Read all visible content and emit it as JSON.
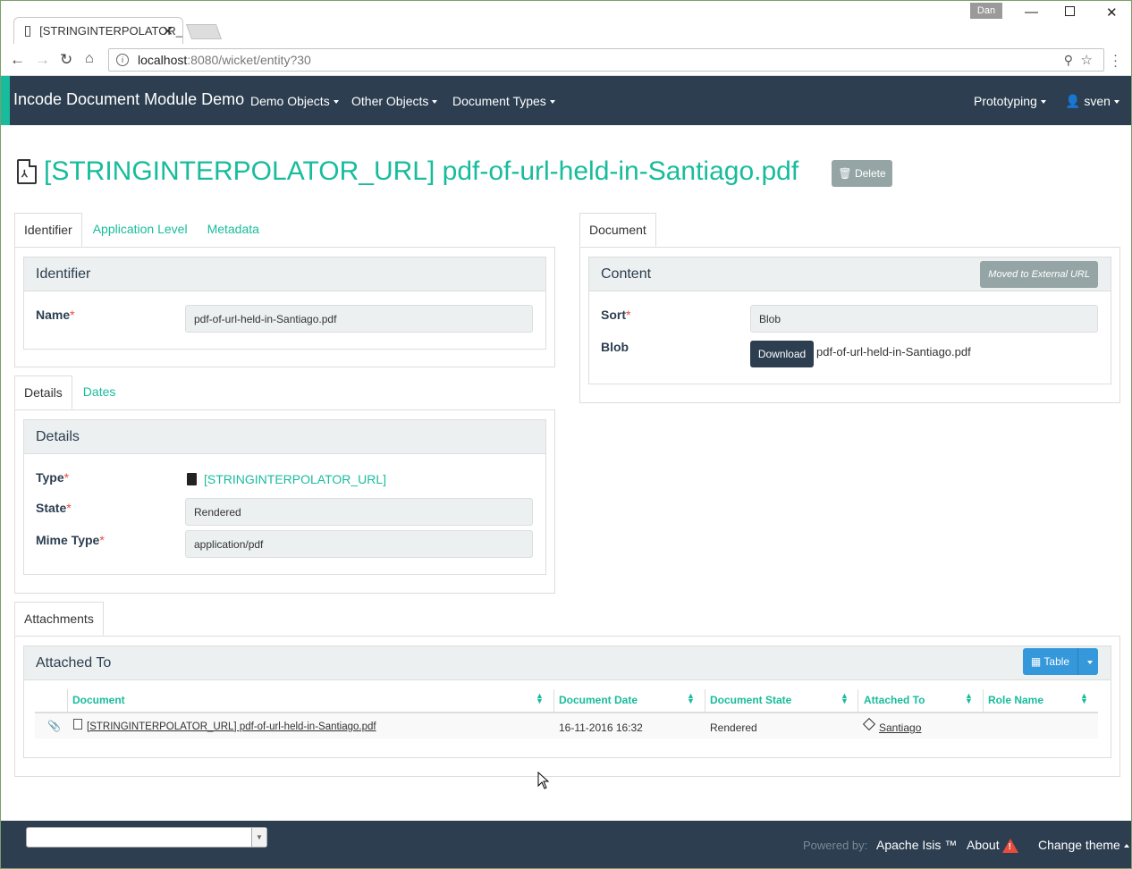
{
  "browser": {
    "tab_title": "[STRINGINTERPOLATOR_",
    "user_badge": "Dan",
    "url_host": "localhost",
    "url_path": ":8080/wicket/entity?30"
  },
  "navbar": {
    "brand": "Incode Document Module Demo",
    "menus": [
      "Demo Objects",
      "Other Objects",
      "Document Types"
    ],
    "prototyping": "Prototyping",
    "user": "sven"
  },
  "entity": {
    "title": "[STRINGINTERPOLATOR_URL] pdf-of-url-held-in-Santiago.pdf",
    "delete_label": "Delete",
    "pdf_glyph": "⅄"
  },
  "left_tabs": [
    "Identifier",
    "Application Level",
    "Metadata"
  ],
  "identifier_panel": {
    "heading": "Identifier",
    "name_label": "Name",
    "name_value": "pdf-of-url-held-in-Santiago.pdf"
  },
  "details_tabs": [
    "Details",
    "Dates"
  ],
  "details_panel": {
    "heading": "Details",
    "type_label": "Type",
    "type_value": "[STRINGINTERPOLATOR_URL]",
    "state_label": "State",
    "state_value": "Rendered",
    "mime_label": "Mime Type",
    "mime_value": "application/pdf"
  },
  "right_tabs": [
    "Document"
  ],
  "content_panel": {
    "heading": "Content",
    "moved_label": "Moved to External URL",
    "sort_label": "Sort",
    "sort_value": "Blob",
    "blob_label": "Blob",
    "download_label": "Download",
    "blob_name": "pdf-of-url-held-in-Santiago.pdf"
  },
  "attachments": {
    "tab": "Attachments",
    "heading": "Attached To",
    "table_button": "Table",
    "columns": [
      "Document",
      "Document Date",
      "Document State",
      "Attached To",
      "Role Name"
    ],
    "rows": [
      {
        "document": "[STRINGINTERPOLATOR_URL] pdf-of-url-held-in-Santiago.pdf",
        "date": "16-11-2016 16:32",
        "state": "Rendered",
        "attached_to": "Santiago",
        "role": ""
      }
    ]
  },
  "footer": {
    "powered_by": "Powered by:",
    "isis": "Apache Isis ™",
    "about": "About",
    "change_theme": "Change theme"
  },
  "colors": {
    "navbar": "#2c3e50",
    "accent": "#18bc9c",
    "danger": "#e74c3c",
    "info": "#3498db",
    "muted": "#95a5a6"
  }
}
